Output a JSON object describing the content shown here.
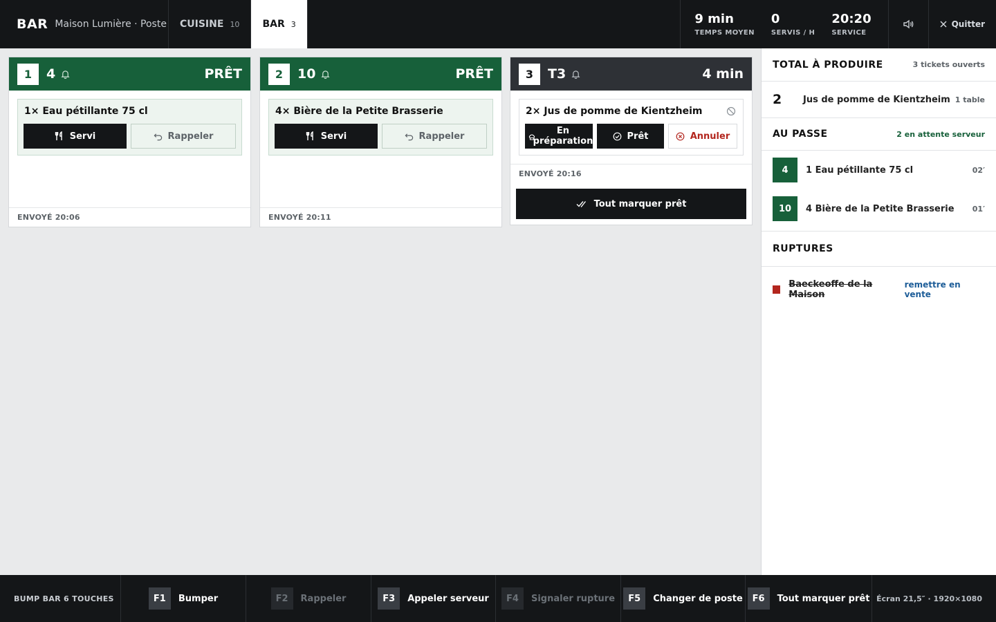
{
  "header": {
    "station": "BAR",
    "subtitle": "Maison Lumière · Poste",
    "tabs": [
      {
        "label": "CUISINE",
        "count": "10"
      },
      {
        "label": "BAR",
        "count": "3"
      }
    ],
    "stats": [
      {
        "value": "9 min",
        "label": "TEMPS MOYEN"
      },
      {
        "value": "0",
        "label": "SERVIS / H"
      },
      {
        "value": "20:20",
        "label": "SERVICE"
      }
    ],
    "sound_icon": "speaker-icon",
    "quit_label": "Quitter"
  },
  "tickets": [
    {
      "num": "1",
      "table": "4",
      "status": "PRÊT",
      "line": "1× Eau pétillante 75 cl",
      "served_label": "Servi",
      "recall_label": "Rappeler",
      "footer": "ENVOYÉ 20:06"
    },
    {
      "num": "2",
      "table": "10",
      "status": "PRÊT",
      "line": "4× Bière de la Petite Brasserie",
      "served_label": "Servi",
      "recall_label": "Rappeler",
      "footer": "ENVOYÉ 20:11"
    },
    {
      "num": "3",
      "table": "T3",
      "status": "4 min",
      "line": "2× Jus de pomme de Kientzheim",
      "prep_label_1": "En",
      "prep_label_2": "préparation",
      "ready_label": "Prêt",
      "cancel_label": "Annuler",
      "footer": "ENVOYÉ 20:16",
      "all_ready_label": "Tout marquer prêt"
    }
  ],
  "panel": {
    "total": {
      "title": "TOTAL À PRODUIRE",
      "meta": "3 tickets ouverts",
      "items": [
        {
          "qty": "2",
          "name": "Jus de pomme de Kientzheim",
          "meta": "1 table"
        }
      ]
    },
    "pass": {
      "title": "AU PASSE",
      "meta": "2 en attente serveur",
      "items": [
        {
          "table": "4",
          "text": "1 Eau pétillante 75 cl",
          "time": "02′"
        },
        {
          "table": "10",
          "text": "4 Bière de la Petite Brasserie",
          "time": "01′"
        }
      ]
    },
    "ruptures": {
      "title": "RUPTURES",
      "items": [
        {
          "name": "Baeckeoffe de la Maison",
          "action": "remettre en vente"
        }
      ]
    }
  },
  "footer": {
    "label": "BUMP BAR 6 TOUCHES",
    "keys": [
      {
        "key": "F1",
        "label": "Bumper",
        "enabled": true
      },
      {
        "key": "F2",
        "label": "Rappeler",
        "enabled": false
      },
      {
        "key": "F3",
        "label": "Appeler serveur",
        "enabled": true
      },
      {
        "key": "F4",
        "label": "Signaler rupture",
        "enabled": false
      },
      {
        "key": "F5",
        "label": "Changer de poste",
        "enabled": true
      },
      {
        "key": "F6",
        "label": "Tout marquer prêt",
        "enabled": true
      }
    ],
    "screen": "Écran 21,5″ · 1920×1080"
  },
  "colors": {
    "ready_green": "#17603a",
    "dark": "#141618",
    "danger_red": "#b3261e",
    "link_blue": "#1d5d98"
  }
}
